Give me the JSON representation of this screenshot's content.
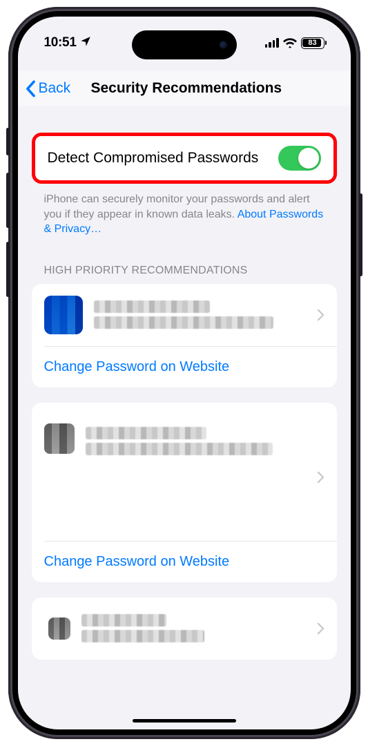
{
  "status": {
    "time": "10:51",
    "battery": "83"
  },
  "nav": {
    "back": "Back",
    "title": "Security Recommendations"
  },
  "toggle": {
    "label": "Detect Compromised Passwords"
  },
  "footer": {
    "text": "iPhone can securely monitor your passwords and alert you if they appear in known data leaks. ",
    "link": "About Passwords & Privacy…"
  },
  "section_header": "HIGH PRIORITY RECOMMENDATIONS",
  "action_label": "Change Password on Website"
}
